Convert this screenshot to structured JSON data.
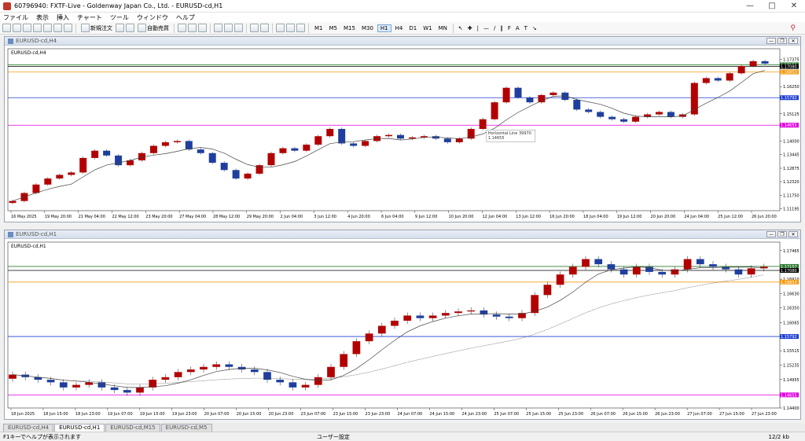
{
  "window": {
    "title": "60796940: FXTF-Live - Goldenway Japan Co., Ltd. - EURUSD-cd,H1"
  },
  "menu": [
    "ファイル",
    "表示",
    "挿入",
    "チャート",
    "ツール",
    "ウィンドウ",
    "ヘルプ"
  ],
  "toolbar": {
    "new_order": "新規注文",
    "auto_trade": "自動売買",
    "timeframes": [
      "M1",
      "M5",
      "M15",
      "M30",
      "H1",
      "H4",
      "D1",
      "W1",
      "MN"
    ],
    "active_timeframe": "H1"
  },
  "charts": [
    {
      "window_title": "EURUSD-cd,H4",
      "label": "EURUSD-cd,H4",
      "tooltip_title": "Horizontal Line 39970",
      "tooltip_value": "1.14655"
    },
    {
      "window_title": "EURUSD-cd,H1",
      "label": "EURUSD-cd,H1"
    }
  ],
  "chart_data": [
    {
      "type": "line",
      "title": "EURUSD-cd,H4",
      "y_ticks": [
        1.17375,
        1.1625,
        1.15125,
        1.14,
        1.13445,
        1.12875,
        1.1232,
        1.1175,
        1.11195
      ],
      "x_ticks": [
        "16 May 2025",
        "19 May 20:00",
        "21 May 04:00",
        "22 May 12:00",
        "23 May 20:00",
        "27 May 04:00",
        "28 May 12:00",
        "29 May 20:00",
        "2 Jun 04:00",
        "3 Jun 12:00",
        "4 Jun 20:00",
        "6 Jun 04:00",
        "9 Jun 12:00",
        "10 Jun 20:00",
        "12 Jun 04:00",
        "13 Jun 12:00",
        "16 Jun 20:00",
        "18 Jun 04:00",
        "19 Jun 12:00",
        "20 Jun 20:00",
        "24 Jun 04:00",
        "25 Jun 12:00",
        "26 Jun 20:00"
      ],
      "horizontal_lines": [
        {
          "value": 1.17151,
          "color": "#2e7d32",
          "label": "1.17151"
        },
        {
          "value": 1.1708,
          "color": "#000000",
          "label": "1.17080"
        },
        {
          "value": 1.16853,
          "color": "#f39c12",
          "label": "1.16853"
        },
        {
          "value": 1.15792,
          "color": "#1f3fd1",
          "label": "1.15792"
        },
        {
          "value": 1.14655,
          "color": "#e000e0",
          "label": "1.14655"
        }
      ],
      "ylim": [
        1.1112,
        1.1775
      ],
      "close_series": [
        1.1152,
        1.1185,
        1.122,
        1.1245,
        1.126,
        1.127,
        1.133,
        1.136,
        1.134,
        1.13,
        1.132,
        1.135,
        1.138,
        1.1395,
        1.14,
        1.1365,
        1.135,
        1.131,
        1.128,
        1.1245,
        1.1265,
        1.13,
        1.135,
        1.137,
        1.136,
        1.1385,
        1.142,
        1.145,
        1.139,
        1.138,
        1.14,
        1.142,
        1.1425,
        1.141,
        1.1415,
        1.142,
        1.141,
        1.1395,
        1.141,
        1.145,
        1.149,
        1.156,
        1.162,
        1.158,
        1.156,
        1.159,
        1.16,
        1.157,
        1.153,
        1.152,
        1.15,
        1.149,
        1.148,
        1.15,
        1.151,
        1.152,
        1.15,
        1.151,
        1.164,
        1.166,
        1.165,
        1.168,
        1.171,
        1.173,
        1.172
      ]
    },
    {
      "type": "line",
      "title": "EURUSD-cd,H1",
      "y_ticks": [
        1.17465,
        1.17157,
        1.1708,
        1.1691,
        1.16853,
        1.1663,
        1.1635,
        1.16065,
        1.15792,
        1.15515,
        1.15235,
        1.14955,
        1.14655,
        1.144
      ],
      "x_ticks": [
        "18 Jun 2025",
        "18 Jun 15:00",
        "18 Jun 23:00",
        "19 Jun 07:00",
        "19 Jun 15:00",
        "19 Jun 23:00",
        "20 Jun 07:00",
        "20 Jun 15:00",
        "20 Jun 23:00",
        "23 Jun 07:00",
        "23 Jun 15:00",
        "23 Jun 23:00",
        "24 Jun 07:00",
        "24 Jun 15:00",
        "24 Jun 23:00",
        "25 Jun 07:00",
        "25 Jun 15:00",
        "25 Jun 23:00",
        "26 Jun 07:00",
        "26 Jun 15:00",
        "26 Jun 23:00",
        "27 Jun 07:00",
        "27 Jun 15:00",
        "27 Jun 23:00"
      ],
      "horizontal_lines": [
        {
          "value": 1.17157,
          "color": "#2e7d32",
          "label": "1.17157"
        },
        {
          "value": 1.1708,
          "color": "#000000",
          "label": "1.17080"
        },
        {
          "value": 1.16853,
          "color": "#f39c12",
          "label": "1.16853"
        },
        {
          "value": 1.15792,
          "color": "#1f3fd1",
          "label": "1.15792"
        },
        {
          "value": 1.14655,
          "color": "#e000e0",
          "label": "1.14655"
        }
      ],
      "ylim": [
        1.144,
        1.176
      ],
      "close_series": [
        1.1505,
        1.15,
        1.1495,
        1.149,
        1.148,
        1.1485,
        1.149,
        1.148,
        1.1475,
        1.147,
        1.148,
        1.1495,
        1.15,
        1.151,
        1.1515,
        1.152,
        1.1525,
        1.152,
        1.1515,
        1.151,
        1.1495,
        1.149,
        1.148,
        1.1485,
        1.15,
        1.152,
        1.1545,
        1.157,
        1.1585,
        1.16,
        1.161,
        1.162,
        1.1615,
        1.162,
        1.1625,
        1.1628,
        1.163,
        1.1622,
        1.1618,
        1.1615,
        1.1625,
        1.166,
        1.168,
        1.17,
        1.1715,
        1.173,
        1.172,
        1.171,
        1.17,
        1.1715,
        1.1705,
        1.17,
        1.171,
        1.173,
        1.172,
        1.1715,
        1.171,
        1.17,
        1.1712,
        1.1715
      ]
    }
  ],
  "bottom_tabs": [
    "EURUSD-cd,H4",
    "EURUSD-cd,H1",
    "EURUSD-cd,M15",
    "EURUSD-cd,M5"
  ],
  "active_tab": "EURUSD-cd,H1",
  "status": {
    "help": "F1キーでヘルプが表示されます",
    "profile": "ユーザー設定",
    "traffic": "12/2 kb"
  }
}
